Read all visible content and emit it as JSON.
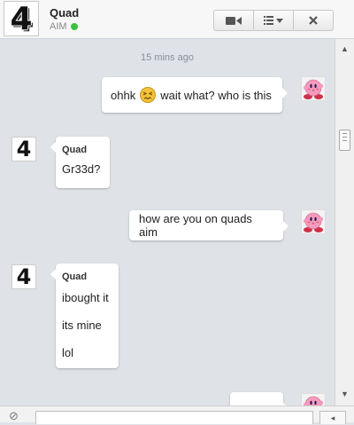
{
  "contact": {
    "name": "Quad",
    "status": "AIM",
    "avatar_glyph": "4",
    "status_color": "#3fbf3f"
  },
  "header_buttons": {
    "video_icon": "video-camera-icon",
    "menu_icon": "list-menu-icon",
    "close_icon": "close-icon"
  },
  "timestamp": "15 mins ago",
  "messages": [
    {
      "from": "me",
      "text_before": "ohhk",
      "emoji": "confounded-face-emoji",
      "text_after": "wait what? who is this"
    },
    {
      "from": "Quad",
      "sender": "Quad",
      "lines": [
        "Gr33d?"
      ]
    },
    {
      "from": "me",
      "text": "how are you on quads aim"
    },
    {
      "from": "Quad",
      "sender": "Quad",
      "lines": [
        "ibought it",
        "its mine",
        "lol"
      ]
    }
  ],
  "input": {
    "value": "",
    "placeholder": ""
  }
}
